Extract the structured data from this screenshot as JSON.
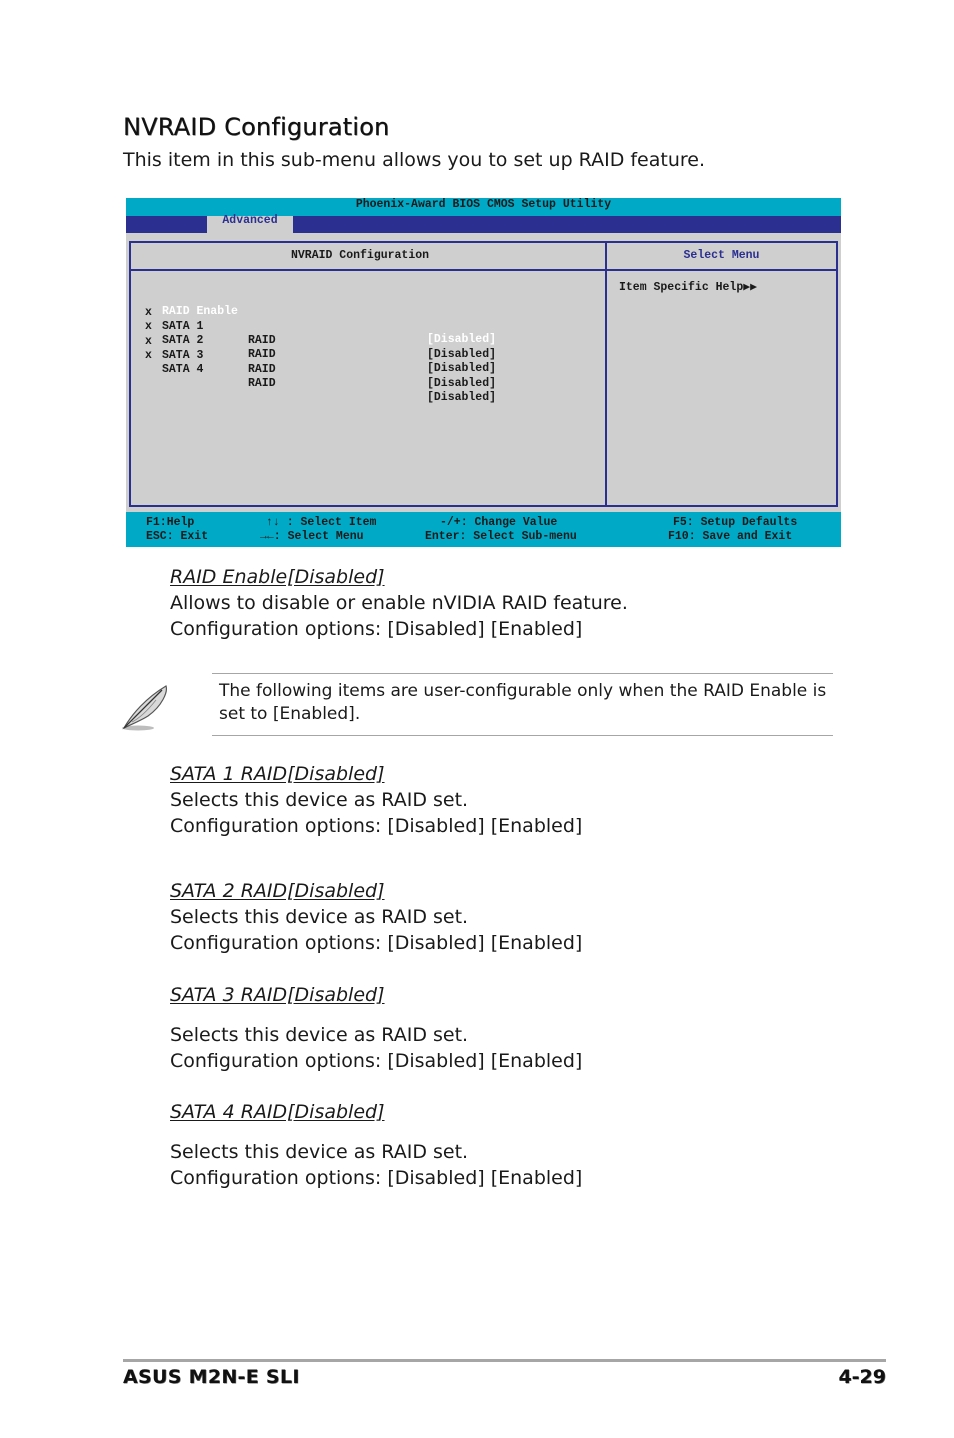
{
  "section": {
    "title": "NVRAID Configuration",
    "intro": "This item in this sub-menu allows you to set up RAID feature."
  },
  "bios": {
    "title": "Phoenix-Award BIOS CMOS Setup Utility",
    "active_tab": "Advanced",
    "main_panel_title": "NVRAID Configuration",
    "side_panel_title": "Select Menu",
    "help_text": "Item Specific Help▶▶",
    "items": [
      {
        "mark": "",
        "label": "RAID Enable",
        "suffix": "",
        "value": "[Disabled]",
        "selected": true
      },
      {
        "mark": "x",
        "label": "SATA 1",
        "suffix": "RAID",
        "value": "[Disabled]",
        "selected": false
      },
      {
        "mark": "x",
        "label": "SATA 2",
        "suffix": "RAID",
        "value": "[Disabled]",
        "selected": false
      },
      {
        "mark": "x",
        "label": "SATA 3",
        "suffix": "RAID",
        "value": "[Disabled]",
        "selected": false
      },
      {
        "mark": "x",
        "label": "SATA 4",
        "suffix": "RAID",
        "value": "[Disabled]",
        "selected": false
      }
    ],
    "footer": {
      "f1": "F1:Help",
      "esc": "ESC: Exit",
      "select_item": "↑↓ : Select Item",
      "select_menu": "→←: Select Menu",
      "change_value": "-/+: Change Value",
      "enter": "Enter: Select Sub-menu",
      "f5": "F5: Setup Defaults",
      "f10": "F10: Save and Exit"
    },
    "colors": {
      "titlebar": "#00aac6",
      "menubar": "#2b2f8f",
      "panel_bg": "#cfcfcf",
      "selected_text": "#ffffff"
    }
  },
  "items": [
    {
      "title": "RAID Enable[Disabled]",
      "description": "Allows to disable or enable nVIDIA RAID feature.",
      "options": "Configuration options: [Disabled] [Enabled]"
    },
    {
      "title": "SATA 1 RAID[Disabled]",
      "description": "Selects this device as RAID set.",
      "options": "Configuration options: [Disabled] [Enabled]"
    },
    {
      "title": "SATA 2 RAID[Disabled]",
      "description": "Selects this device as RAID set.",
      "options": "Configuration options: [Disabled] [Enabled]"
    },
    {
      "title": "SATA 3 RAID[Disabled]",
      "description": "Selects this device as RAID set.",
      "options": "Configuration options: [Disabled] [Enabled]"
    },
    {
      "title": "SATA 4 RAID[Disabled]",
      "description": "Selects this device as RAID set.",
      "options": "Configuration options: [Disabled] [Enabled]"
    }
  ],
  "note": {
    "icon": "feather-pen-icon",
    "text": "The following items are user-configurable only when the RAID Enable is set to [Enabled]."
  },
  "page_footer": {
    "product": "ASUS M2N-E SLI",
    "page_number": "4-29"
  }
}
